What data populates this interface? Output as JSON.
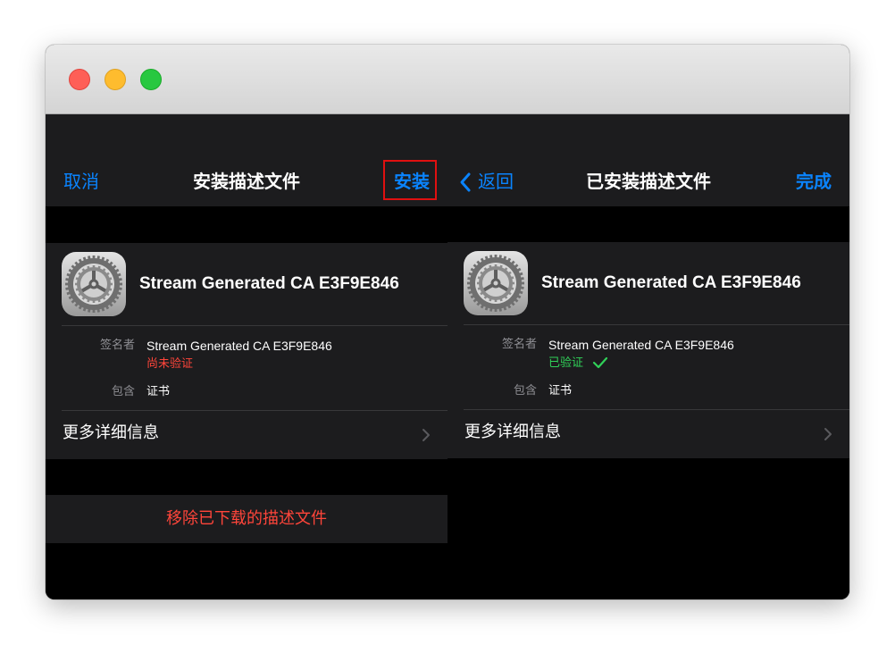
{
  "window": {
    "traffic_lights": [
      {
        "name": "close",
        "color": "#fe5f57"
      },
      {
        "name": "minimize",
        "color": "#febc2e"
      },
      {
        "name": "zoom",
        "color": "#28c840"
      }
    ]
  },
  "left_screen": {
    "nav": {
      "cancel_label": "取消",
      "title": "安装描述文件",
      "install_label": "安装",
      "install_highlight_color": "#e01010"
    },
    "profile": {
      "icon": "settings-gear-icon",
      "name": "Stream Generated CA E3F9E846"
    },
    "details": {
      "signer_label": "签名者",
      "signer_value": "Stream Generated CA E3F9E846",
      "status": "尚未验证",
      "status_color": "#ff453a",
      "contains_label": "包含",
      "contains_value": "证书"
    },
    "more_details_label": "更多详细信息",
    "remove_label": "移除已下载的描述文件"
  },
  "right_screen": {
    "nav": {
      "back_label": "返回",
      "title": "已安装描述文件",
      "done_label": "完成"
    },
    "profile": {
      "icon": "settings-gear-icon",
      "name": "Stream Generated CA E3F9E846"
    },
    "details": {
      "signer_label": "签名者",
      "signer_value": "Stream Generated CA E3F9E846",
      "status": "已验证",
      "status_color": "#30d158",
      "status_icon": "checkmark-icon",
      "contains_label": "包含",
      "contains_value": "证书"
    },
    "more_details_label": "更多详细信息"
  },
  "colors": {
    "accent_blue": "#0a84ff",
    "destructive_red": "#ff453a",
    "success_green": "#30d158",
    "cell_background": "#1c1c1e",
    "screen_background": "#000000"
  }
}
